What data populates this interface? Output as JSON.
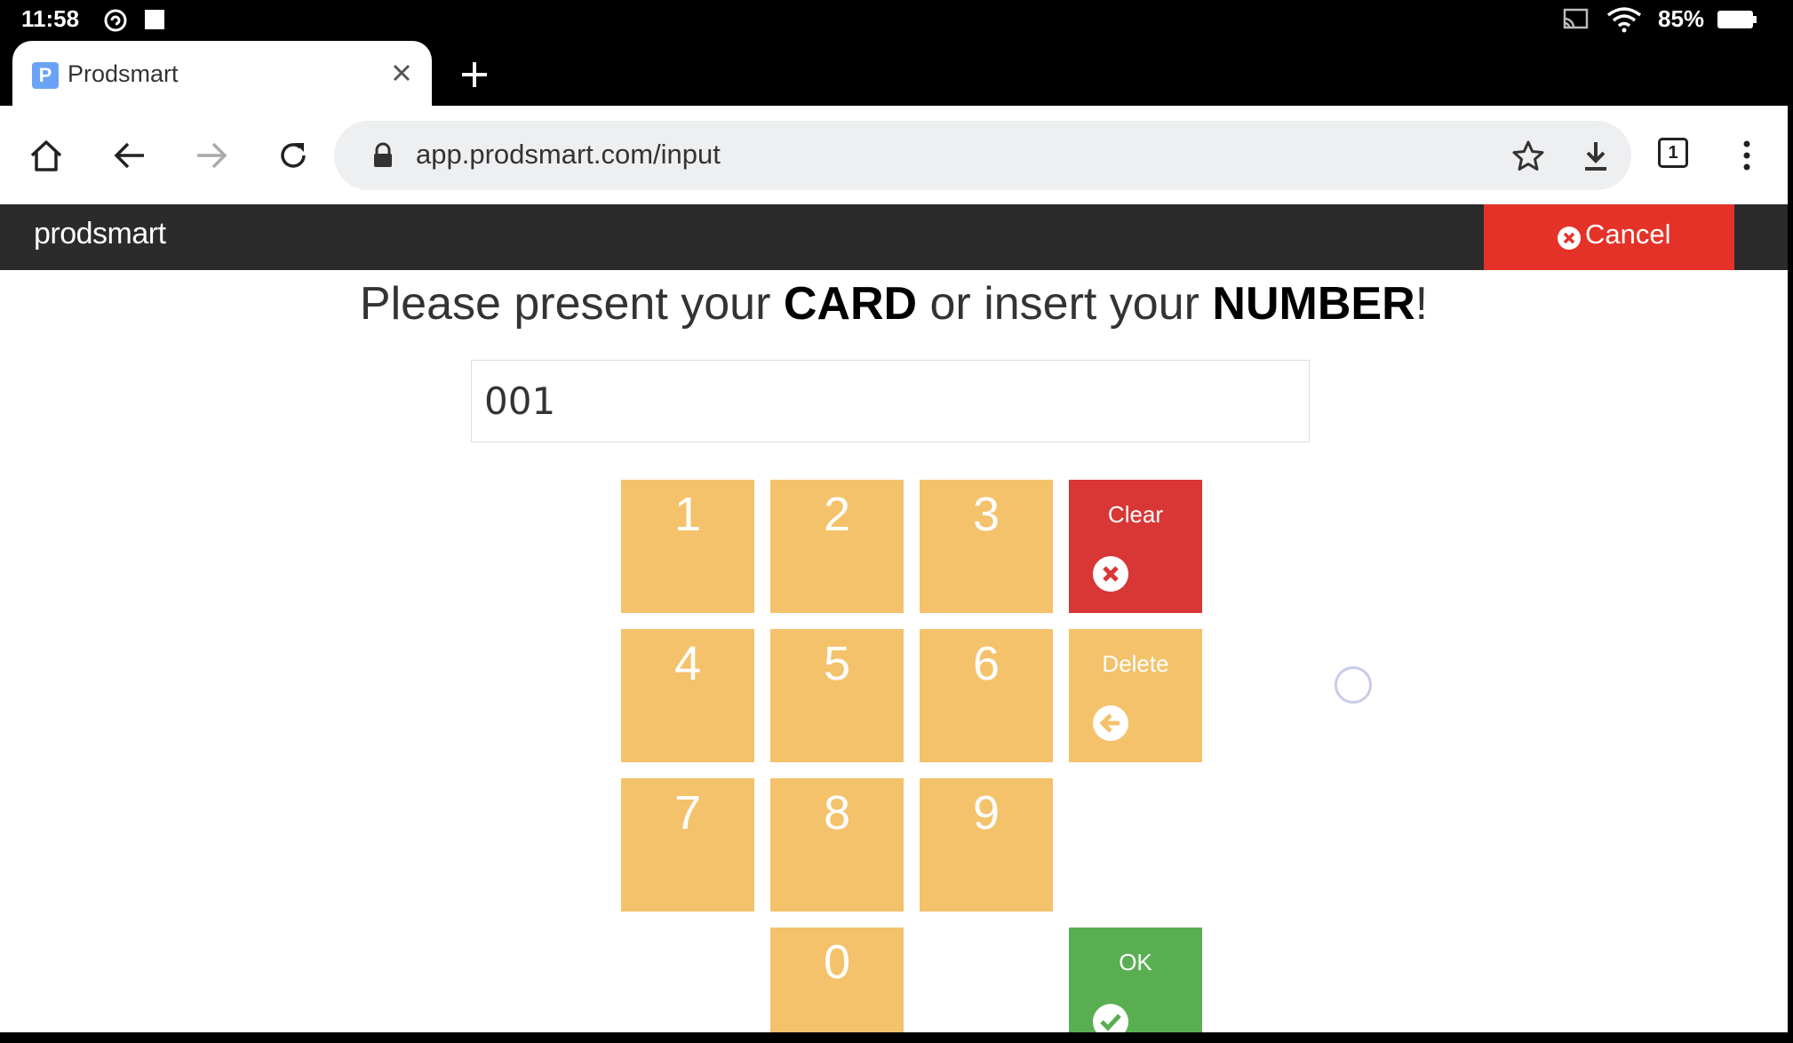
{
  "status_bar": {
    "time": "11:58",
    "battery": "85%"
  },
  "browser": {
    "tab_title": "Prodsmart",
    "favicon_letter": "P",
    "url": "app.prodsmart.com/input",
    "tab_count": "1"
  },
  "app": {
    "brand": "prodsmart",
    "cancel_label": "Cancel"
  },
  "prompt": {
    "part1": "Please present your ",
    "bold1": "CARD",
    "part2": " or insert your ",
    "bold2": "NUMBER",
    "part3": "!"
  },
  "input": {
    "value": "001"
  },
  "keypad": {
    "k1": "1",
    "k2": "2",
    "k3": "3",
    "k4": "4",
    "k5": "5",
    "k6": "6",
    "k7": "7",
    "k8": "8",
    "k9": "9",
    "k0": "0",
    "clear": "Clear",
    "delete": "Delete",
    "ok": "OK"
  },
  "colors": {
    "key": "#f4c26a",
    "clear": "#d93636",
    "ok": "#5aae52",
    "cancel": "#e53228",
    "header": "#2b2b2b"
  }
}
